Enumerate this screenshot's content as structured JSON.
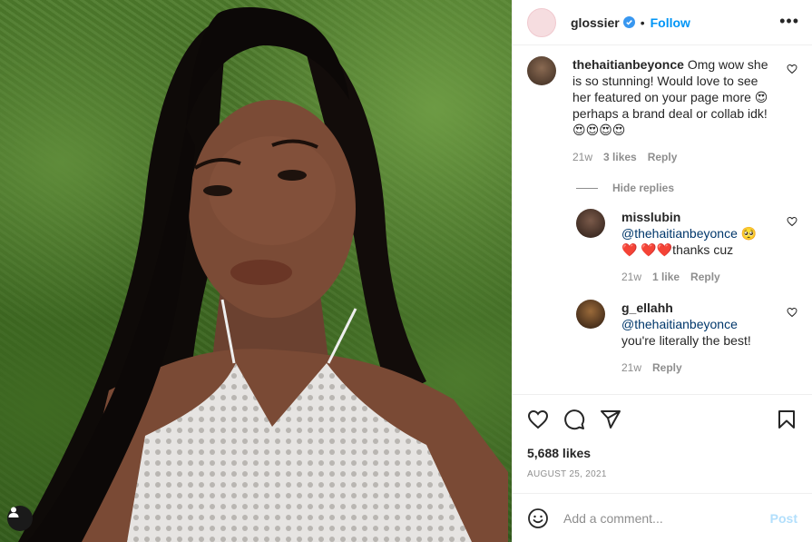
{
  "post": {
    "author": "glossier",
    "follow_label": "Follow",
    "separator": "•",
    "more_label": "•••"
  },
  "comments": [
    {
      "user": "thehaitianbeyonce",
      "text": "Omg wow she is so stunning! Would love to see her featured on your page more 😍 perhaps a brand deal or collab idk! 😍😍😍😍",
      "time": "21w",
      "likes": "3 likes",
      "reply_label": "Reply",
      "avatar_color": "#5a4636"
    }
  ],
  "hide_replies_label": "Hide replies",
  "replies": [
    {
      "user": "misslubin",
      "mention": "@thehaitianbeyonce",
      "text": "🥺❤️ ❤️❤️thanks cuz",
      "time": "21w",
      "likes": "1 like",
      "reply_label": "Reply",
      "avatar_color": "#3a2a24"
    },
    {
      "user": "g_ellahh",
      "mention": "@thehaitianbeyonce",
      "text": "you're literally the best!",
      "time": "21w",
      "reply_label": "Reply",
      "avatar_color": "#4a3220"
    }
  ],
  "likes_count": "5,688 likes",
  "date": "AUGUST 25, 2021",
  "add_comment": {
    "placeholder": "Add a comment...",
    "post_label": "Post"
  },
  "colors": {
    "accent": "#0095f6",
    "post_disabled": "#b2dffc",
    "muted": "#8e8e8e"
  }
}
